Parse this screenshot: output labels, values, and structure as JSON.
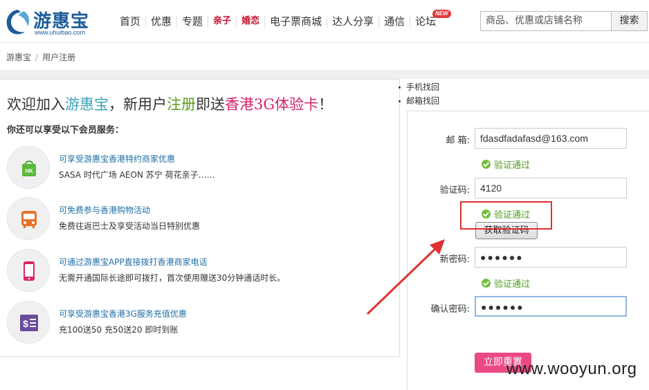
{
  "header": {
    "logo_text": "游惠宝",
    "logo_url": "www.uhuibao.com",
    "nav": [
      {
        "label": "首页",
        "style": "normal"
      },
      {
        "label": "优惠",
        "style": "normal"
      },
      {
        "label": "专题",
        "style": "normal"
      },
      {
        "label": "亲子",
        "style": "red"
      },
      {
        "label": "婚恋",
        "style": "red"
      },
      {
        "label": "电子票商城",
        "style": "normal"
      },
      {
        "label": "达人分享",
        "style": "normal"
      },
      {
        "label": "通信",
        "style": "normal"
      },
      {
        "label": "论坛",
        "style": "normal",
        "badge": "NEW"
      }
    ],
    "search_placeholder": "商品、优惠或店铺名称",
    "search_button": "搜索"
  },
  "breadcrumb": {
    "home": "游惠宝",
    "sep": "/",
    "current": "用户注册"
  },
  "promo": {
    "welcome_1": "欢迎加入",
    "welcome_brand": "游惠宝",
    "welcome_2": "，新用户",
    "welcome_register": "注册",
    "welcome_3": "即送",
    "welcome_card": "香港3G体验卡",
    "welcome_4": "！",
    "subhead": "你还可以享受以下会员服务：",
    "benefits": [
      {
        "title": "可享受游惠宝香港特约商家优惠",
        "desc": "SASA 时代广场 AEON 苏宁 荷花亲子……",
        "icon": "shopping-bag-icon"
      },
      {
        "title": "可免费参与香港购物活动",
        "desc": "免费往返巴士及享受活动当日特别优惠",
        "icon": "bus-icon"
      },
      {
        "title": "可通过游惠宝APP直接拨打香港商家电话",
        "desc": "无需开通国际长途即可拨打，首次使用赠送30分钟通话时长。",
        "icon": "phone-icon"
      },
      {
        "title": "可享受游惠宝香港3G服务充值优惠",
        "desc": "充100送50 充50送20  即时到账",
        "icon": "recharge-icon"
      }
    ]
  },
  "recover_links": [
    "手机找回",
    "邮箱找回"
  ],
  "form": {
    "email_label": "邮 箱:",
    "email_value": "fdasdfadafasd@163.com",
    "email_status": "验证通过",
    "code_label": "验证码:",
    "code_value": "4120",
    "code_status": "验证通过",
    "get_code_button": "获取验证码",
    "password_label": "新密码:",
    "password_value": "●●●●●●",
    "password_status": "验证通过",
    "confirm_label": "确认密码:",
    "confirm_value": "●●●●●●",
    "reset_button": "立即重置"
  },
  "watermark": "www.wooyun.org",
  "colors": {
    "link_blue": "#1d6fa5",
    "ok_green": "#4f9b1e",
    "highlight_red": "#e03030",
    "button_pink": "#e94a84"
  }
}
